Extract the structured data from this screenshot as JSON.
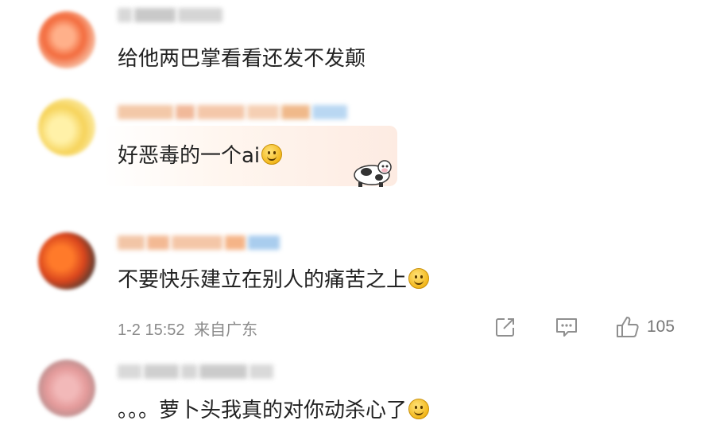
{
  "comments": [
    {
      "text": "给他两巴掌看看还发不发颠",
      "emoji": null
    },
    {
      "text": "好恶毒的一个ai",
      "emoji": "smile-emoji"
    },
    {
      "text": "不要快乐建立在别人的痛苦之上",
      "emoji": "smile-emoji",
      "meta": {
        "time": "1-2 15:52",
        "location": "来自广东"
      },
      "actions": {
        "like_count": "105"
      }
    },
    {
      "text": "。。。萝卜头我真的对你动杀心了",
      "emoji": "smile-emoji"
    }
  ],
  "icons": [
    "share-icon",
    "comment-icon",
    "like-icon",
    "cow-sticker-icon"
  ],
  "colors": {
    "text": "#222222",
    "meta": "#8a8a8a",
    "icon": "#9a9a9a"
  }
}
